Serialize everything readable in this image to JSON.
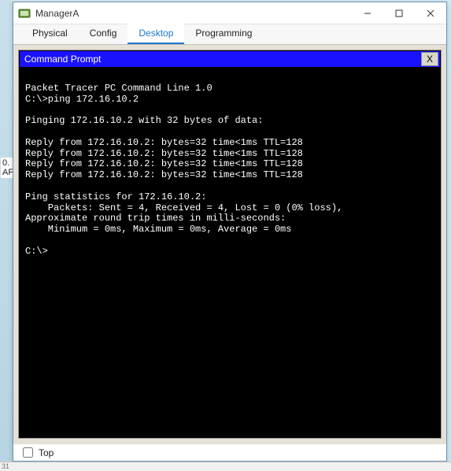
{
  "bg": {
    "line1": "0.",
    "line2": "AF"
  },
  "window": {
    "title": "ManagerA",
    "controls": {
      "min": "—",
      "max": "□",
      "close": "✕"
    }
  },
  "tabs": [
    {
      "label": "Physical",
      "active": false
    },
    {
      "label": "Config",
      "active": false
    },
    {
      "label": "Desktop",
      "active": true
    },
    {
      "label": "Programming",
      "active": false
    }
  ],
  "cmd_window": {
    "title": "Command Prompt",
    "close_label": "X"
  },
  "terminal_lines": [
    "",
    "Packet Tracer PC Command Line 1.0",
    "C:\\>ping 172.16.10.2",
    "",
    "Pinging 172.16.10.2 with 32 bytes of data:",
    "",
    "Reply from 172.16.10.2: bytes=32 time<1ms TTL=128",
    "Reply from 172.16.10.2: bytes=32 time<1ms TTL=128",
    "Reply from 172.16.10.2: bytes=32 time<1ms TTL=128",
    "Reply from 172.16.10.2: bytes=32 time<1ms TTL=128",
    "",
    "Ping statistics for 172.16.10.2:",
    "    Packets: Sent = 4, Received = 4, Lost = 0 (0% loss),",
    "Approximate round trip times in milli-seconds:",
    "    Minimum = 0ms, Maximum = 0ms, Average = 0ms",
    "",
    "C:\\>"
  ],
  "footer": {
    "top_label": "Top"
  },
  "bottom_status": "31"
}
